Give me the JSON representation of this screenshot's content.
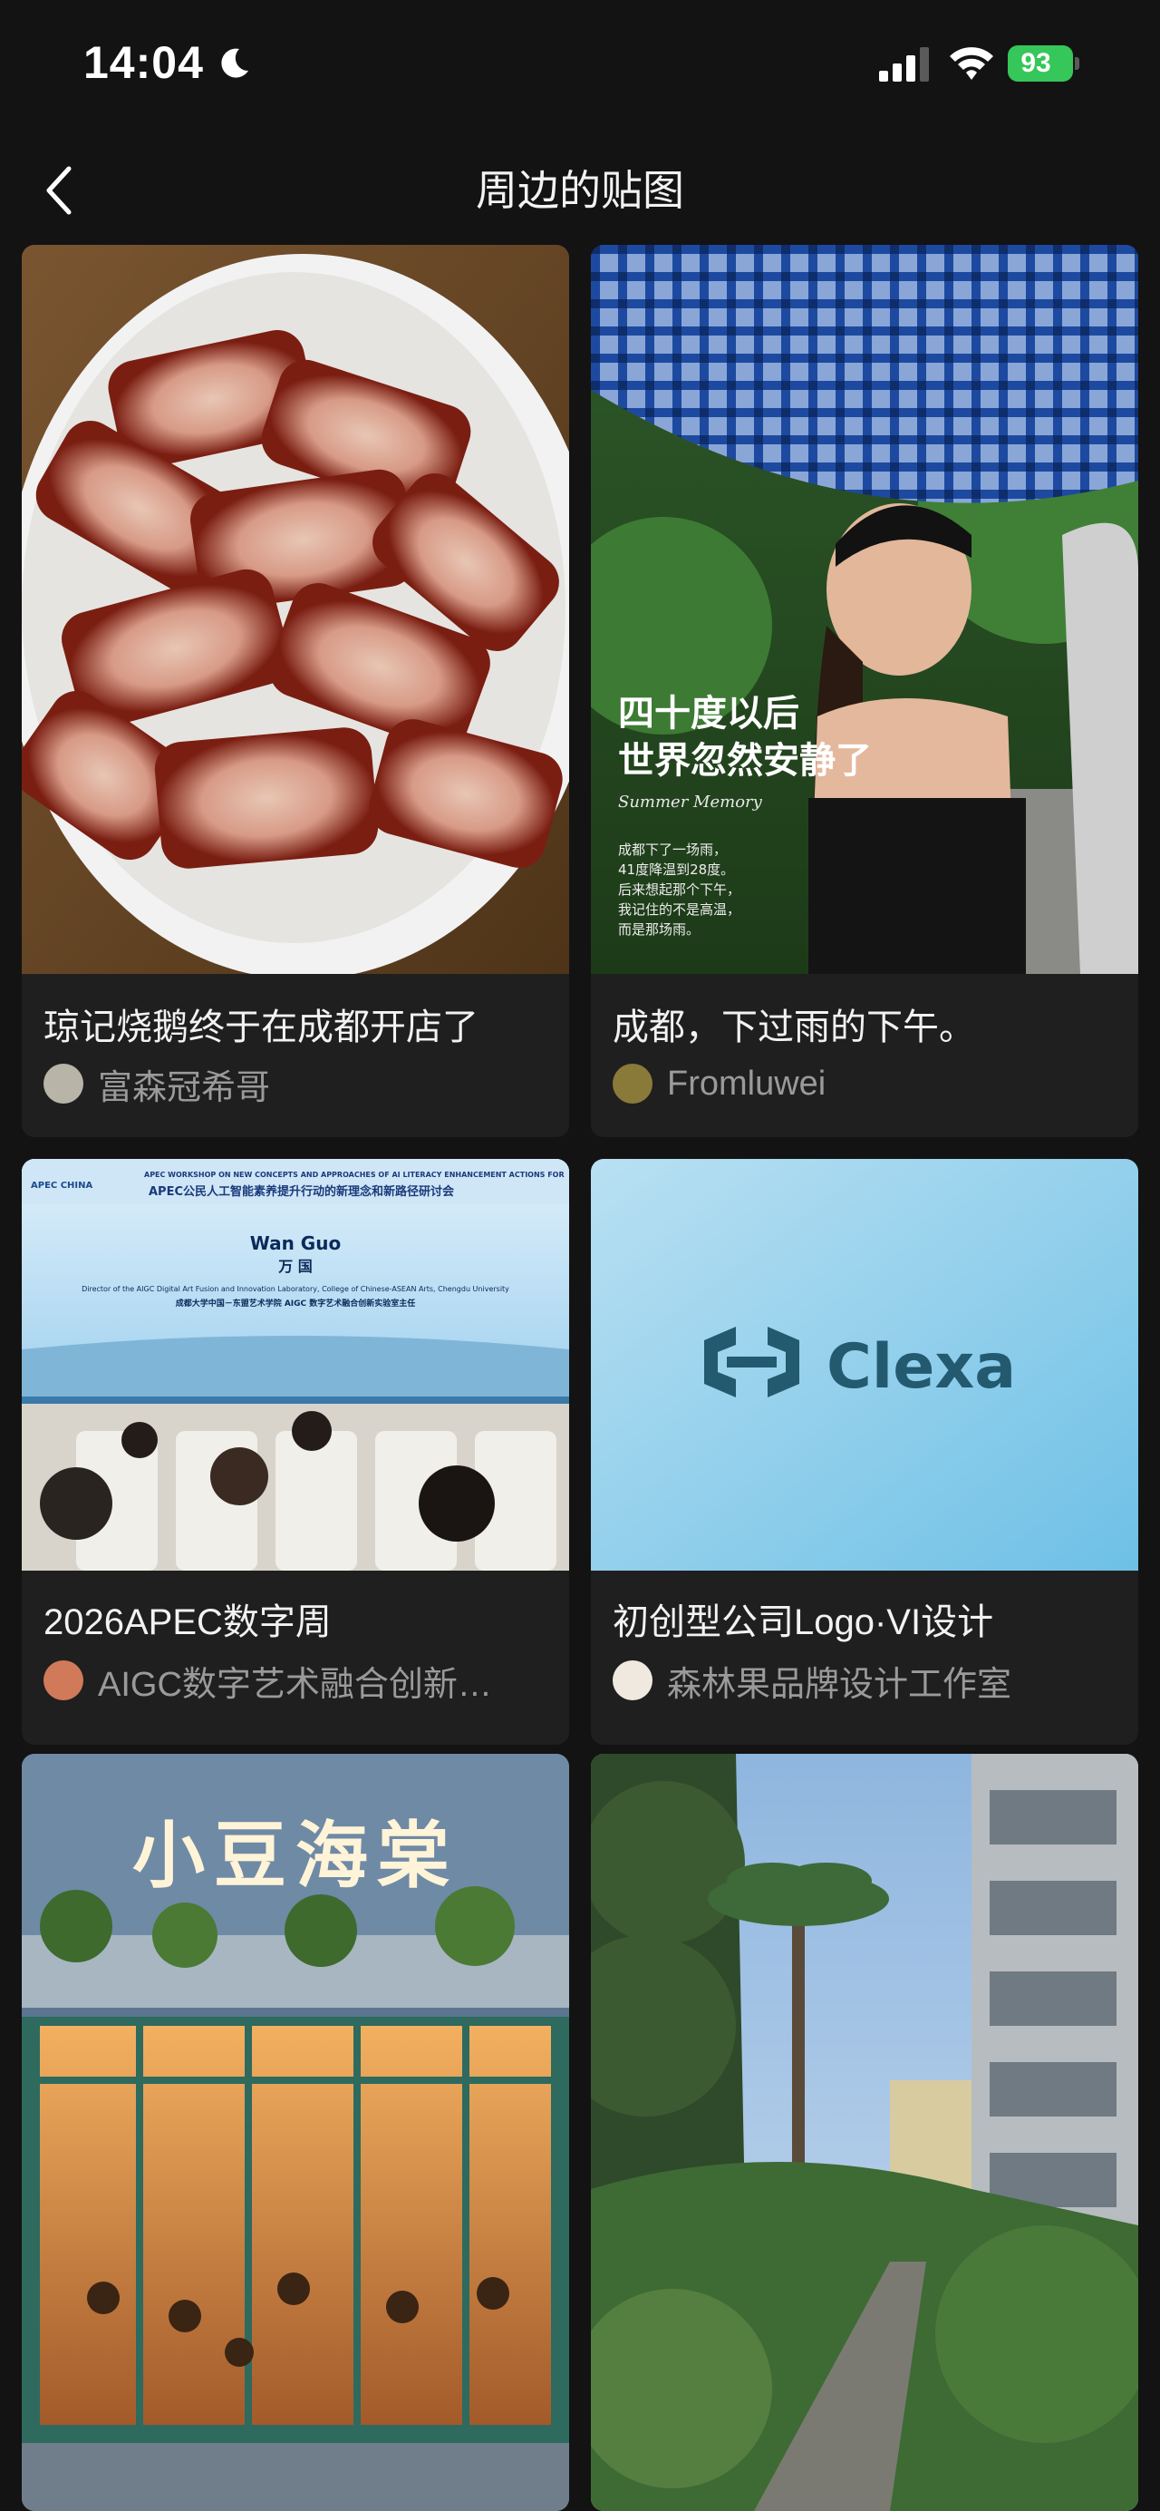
{
  "status_bar": {
    "time": "14:04",
    "battery": "93"
  },
  "nav": {
    "title": "周边的贴图"
  },
  "cards": [
    {
      "title": "琼记烧鹅终于在成都开店了",
      "author": "富森冠希哥",
      "image": "roast-pork-photo"
    },
    {
      "title": "成都，下过雨的下午。",
      "author": "Fromluwei",
      "image": "umbrella-woman-photo",
      "overlay": {
        "headline_1": "四十度以后",
        "headline_2": "世界忽然安静了",
        "script": "Summer Memory",
        "lines": [
          "成都下了一场雨，",
          "41度降温到28度。",
          "后来想起那个下午，",
          "我记住的不是高温，",
          "而是那场雨。"
        ]
      }
    },
    {
      "title": "2026APEC数字周",
      "author": "AIGC数字艺术融合创新…",
      "image": "conference-photo",
      "overlay": {
        "banner_en": "APEC WORKSHOP ON NEW CONCEPTS AND APPROACHES OF AI LITERACY ENHANCEMENT ACTIONS FOR",
        "banner_cn": "APEC公民人工智能素养提升行动的新理念和新路径研讨会",
        "speaker_en": "Wan Guo",
        "speaker_cn": "万 国",
        "speaker_role": "Director of the AIGC Digital Art Fusion and Innovation Laboratory, College of Chinese-ASEAN Arts, Chengdu University",
        "speaker_role_cn": "成都大学中国－东盟艺术学院 AIGC 数字艺术融合创新实验室主任",
        "logo": "APEC CHINA"
      }
    },
    {
      "title": "初创型公司Logo·VI设计",
      "author": "森林果品牌设计工作室",
      "image": "clexa-logo",
      "overlay": {
        "brand": "Clexa"
      }
    },
    {
      "title": "",
      "author": "",
      "image": "restaurant-photo",
      "overlay": {
        "sign": "小豆海棠"
      }
    },
    {
      "title": "",
      "author": "",
      "image": "courtyard-photo"
    }
  ]
}
